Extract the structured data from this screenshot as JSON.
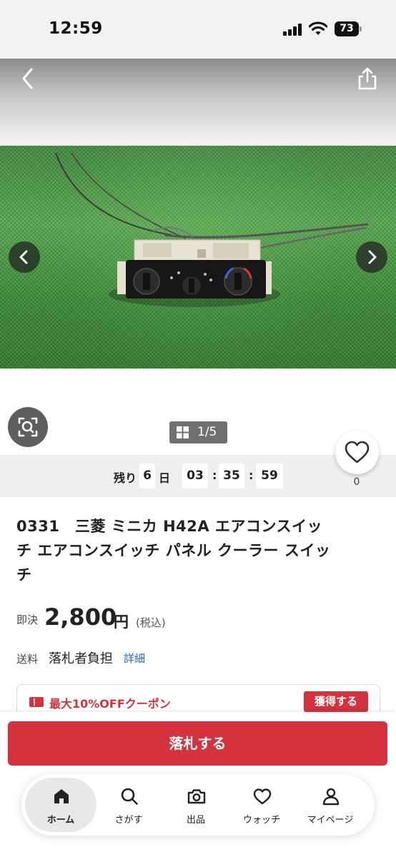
{
  "status_bar": {
    "time": "12:59",
    "battery": "73"
  },
  "gallery": {
    "counter": "1/5"
  },
  "countdown": {
    "label": "残り",
    "days": "6",
    "days_unit": "日",
    "hours": "03",
    "minutes": "35",
    "seconds": "59"
  },
  "watch": {
    "count": "0"
  },
  "item": {
    "title": "0331　三菱 ミニカ H42A エアコンスイッチ エアコンスイッチ パネル クーラー スイッチ",
    "price_label": "即決",
    "price": "2,800",
    "price_unit": "円",
    "price_tax": "(税込)",
    "shipping_label": "送料",
    "shipping_value": "落札者負担",
    "shipping_detail": "詳細"
  },
  "coupon": {
    "text": "最大10%OFFクーポン",
    "button": "獲得する"
  },
  "actions": {
    "bid": "落札する"
  },
  "tabs": [
    {
      "label": "ホーム",
      "icon": "home-icon",
      "active": true
    },
    {
      "label": "さがす",
      "icon": "search-icon",
      "active": false
    },
    {
      "label": "出品",
      "icon": "camera-icon",
      "active": false
    },
    {
      "label": "ウォッチ",
      "icon": "heart-icon",
      "active": false
    },
    {
      "label": "マイページ",
      "icon": "person-icon",
      "active": false
    }
  ],
  "colors": {
    "accent": "#d4323c",
    "link": "#2563c9"
  }
}
